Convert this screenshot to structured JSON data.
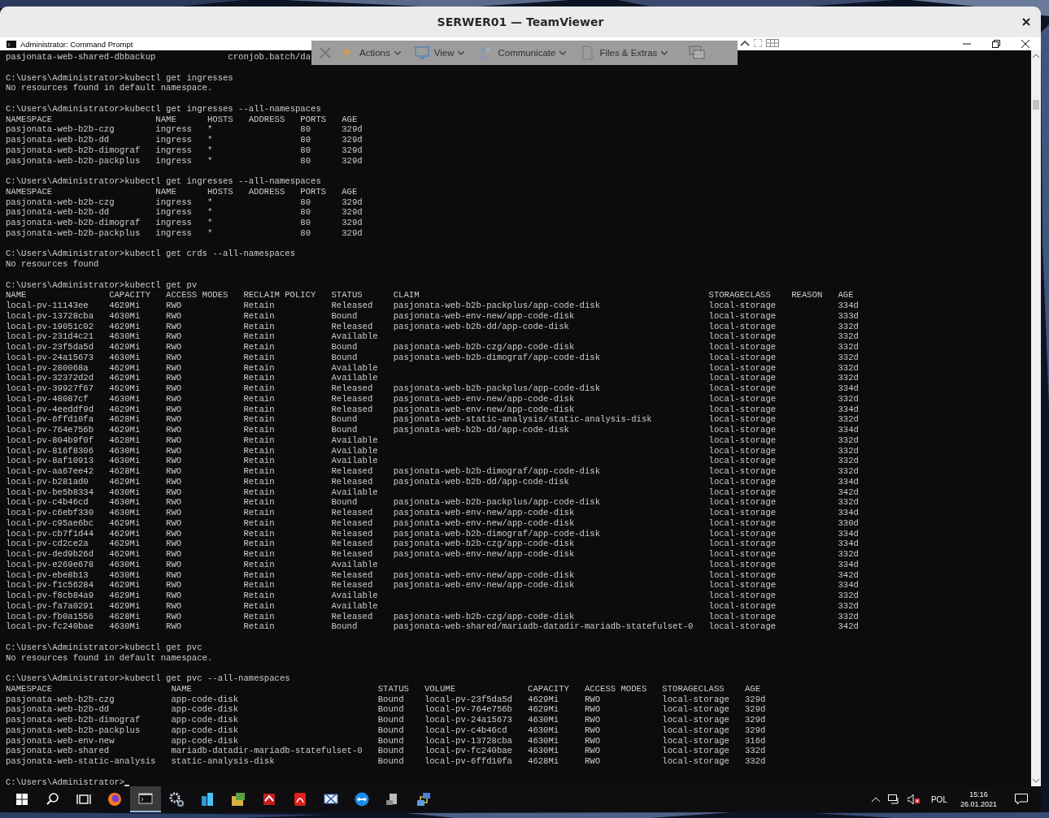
{
  "window": {
    "title": "SERWER01 — TeamViewer"
  },
  "remote_toolbar": {
    "menus": [
      {
        "label": "Actions"
      },
      {
        "label": "View"
      },
      {
        "label": "Communicate"
      },
      {
        "label": "Files & Extras"
      }
    ]
  },
  "console": {
    "title": "Administrator: Command Prompt",
    "blocks": [
      {
        "kind": "text",
        "text": "pasjonata-web-shared-dbbackup              cronjob.batch/da"
      },
      {
        "kind": "command",
        "text": "C:\\Users\\Administrator>kubectl get ingresses"
      },
      {
        "kind": "text",
        "text": "No resources found in default namespace."
      },
      {
        "kind": "command",
        "text": "C:\\Users\\Administrator>kubectl get ingresses --all-namespaces"
      },
      {
        "kind": "table",
        "columns": [
          "NAMESPACE",
          "NAME",
          "HOSTS",
          "ADDRESS",
          "PORTS",
          "AGE"
        ],
        "rows": [
          [
            "pasjonata-web-b2b-czg",
            "ingress",
            "*",
            null,
            "80",
            "329d"
          ],
          [
            "pasjonata-web-b2b-dd",
            "ingress",
            "*",
            null,
            "80",
            "329d"
          ],
          [
            "pasjonata-web-b2b-dimograf",
            "ingress",
            "*",
            null,
            "80",
            "329d"
          ],
          [
            "pasjonata-web-b2b-packplus",
            "ingress",
            "*",
            null,
            "80",
            "329d"
          ]
        ]
      },
      {
        "kind": "command",
        "text": "C:\\Users\\Administrator>kubectl get ingresses --all-namespaces"
      },
      {
        "kind": "table",
        "columns": [
          "NAMESPACE",
          "NAME",
          "HOSTS",
          "ADDRESS",
          "PORTS",
          "AGE"
        ],
        "rows": [
          [
            "pasjonata-web-b2b-czg",
            "ingress",
            "*",
            null,
            "80",
            "329d"
          ],
          [
            "pasjonata-web-b2b-dd",
            "ingress",
            "*",
            null,
            "80",
            "329d"
          ],
          [
            "pasjonata-web-b2b-dimograf",
            "ingress",
            "*",
            null,
            "80",
            "329d"
          ],
          [
            "pasjonata-web-b2b-packplus",
            "ingress",
            "*",
            null,
            "80",
            "329d"
          ]
        ]
      },
      {
        "kind": "command",
        "text": "C:\\Users\\Administrator>kubectl get crds --all-namespaces"
      },
      {
        "kind": "text",
        "text": "No resources found"
      },
      {
        "kind": "command",
        "text": "C:\\Users\\Administrator>kubectl get pv"
      },
      {
        "kind": "table",
        "columns": [
          "NAME",
          "CAPACITY",
          "ACCESS MODES",
          "RECLAIM POLICY",
          "STATUS",
          "CLAIM",
          "STORAGECLASS",
          "REASON",
          "AGE"
        ],
        "rows": [
          [
            "local-pv-11143ee",
            "4629Mi",
            "RWO",
            "Retain",
            "Released",
            "pasjonata-web-b2b-packplus/app-code-disk",
            "local-storage",
            null,
            "334d"
          ],
          [
            "local-pv-13728cba",
            "4630Mi",
            "RWO",
            "Retain",
            "Bound",
            "pasjonata-web-env-new/app-code-disk",
            "local-storage",
            null,
            "333d"
          ],
          [
            "local-pv-19051c02",
            "4629Mi",
            "RWO",
            "Retain",
            "Released",
            "pasjonata-web-b2b-dd/app-code-disk",
            "local-storage",
            null,
            "332d"
          ],
          [
            "local-pv-231d4c21",
            "4630Mi",
            "RWO",
            "Retain",
            "Available",
            null,
            "local-storage",
            null,
            "332d"
          ],
          [
            "local-pv-23f5da5d",
            "4629Mi",
            "RWO",
            "Retain",
            "Bound",
            "pasjonata-web-b2b-czg/app-code-disk",
            "local-storage",
            null,
            "332d"
          ],
          [
            "local-pv-24a15673",
            "4630Mi",
            "RWO",
            "Retain",
            "Bound",
            "pasjonata-web-b2b-dimograf/app-code-disk",
            "local-storage",
            null,
            "332d"
          ],
          [
            "local-pv-280068a",
            "4629Mi",
            "RWO",
            "Retain",
            "Available",
            null,
            "local-storage",
            null,
            "332d"
          ],
          [
            "local-pv-32372d2d",
            "4629Mi",
            "RWO",
            "Retain",
            "Available",
            null,
            "local-storage",
            null,
            "332d"
          ],
          [
            "local-pv-39927f67",
            "4629Mi",
            "RWO",
            "Retain",
            "Released",
            "pasjonata-web-b2b-packplus/app-code-disk",
            "local-storage",
            null,
            "334d"
          ],
          [
            "local-pv-48087cf",
            "4630Mi",
            "RWO",
            "Retain",
            "Released",
            "pasjonata-web-env-new/app-code-disk",
            "local-storage",
            null,
            "332d"
          ],
          [
            "local-pv-4eeddf9d",
            "4629Mi",
            "RWO",
            "Retain",
            "Released",
            "pasjonata-web-env-new/app-code-disk",
            "local-storage",
            null,
            "334d"
          ],
          [
            "local-pv-6ffd10fa",
            "4628Mi",
            "RWO",
            "Retain",
            "Bound",
            "pasjonata-web-static-analysis/static-analysis-disk",
            "local-storage",
            null,
            "332d"
          ],
          [
            "local-pv-764e756b",
            "4629Mi",
            "RWO",
            "Retain",
            "Bound",
            "pasjonata-web-b2b-dd/app-code-disk",
            "local-storage",
            null,
            "334d"
          ],
          [
            "local-pv-804b9f0f",
            "4628Mi",
            "RWO",
            "Retain",
            "Available",
            null,
            "local-storage",
            null,
            "332d"
          ],
          [
            "local-pv-816f8306",
            "4630Mi",
            "RWO",
            "Retain",
            "Available",
            null,
            "local-storage",
            null,
            "332d"
          ],
          [
            "local-pv-8af10913",
            "4630Mi",
            "RWO",
            "Retain",
            "Available",
            null,
            "local-storage",
            null,
            "332d"
          ],
          [
            "local-pv-aa67ee42",
            "4628Mi",
            "RWO",
            "Retain",
            "Released",
            "pasjonata-web-b2b-dimograf/app-code-disk",
            "local-storage",
            null,
            "332d"
          ],
          [
            "local-pv-b281ad0",
            "4629Mi",
            "RWO",
            "Retain",
            "Released",
            "pasjonata-web-b2b-dd/app-code-disk",
            "local-storage",
            null,
            "334d"
          ],
          [
            "local-pv-be5b8334",
            "4630Mi",
            "RWO",
            "Retain",
            "Available",
            null,
            "local-storage",
            null,
            "342d"
          ],
          [
            "local-pv-c4b46cd",
            "4630Mi",
            "RWO",
            "Retain",
            "Bound",
            "pasjonata-web-b2b-packplus/app-code-disk",
            "local-storage",
            null,
            "332d"
          ],
          [
            "local-pv-c6ebf330",
            "4630Mi",
            "RWO",
            "Retain",
            "Released",
            "pasjonata-web-env-new/app-code-disk",
            "local-storage",
            null,
            "334d"
          ],
          [
            "local-pv-c95ae6bc",
            "4629Mi",
            "RWO",
            "Retain",
            "Released",
            "pasjonata-web-env-new/app-code-disk",
            "local-storage",
            null,
            "330d"
          ],
          [
            "local-pv-cb7f1d44",
            "4629Mi",
            "RWO",
            "Retain",
            "Released",
            "pasjonata-web-b2b-dimograf/app-code-disk",
            "local-storage",
            null,
            "334d"
          ],
          [
            "local-pv-cd2ce2a",
            "4629Mi",
            "RWO",
            "Retain",
            "Released",
            "pasjonata-web-b2b-czg/app-code-disk",
            "local-storage",
            null,
            "334d"
          ],
          [
            "local-pv-ded9b26d",
            "4629Mi",
            "RWO",
            "Retain",
            "Released",
            "pasjonata-web-env-new/app-code-disk",
            "local-storage",
            null,
            "332d"
          ],
          [
            "local-pv-e269e678",
            "4630Mi",
            "RWO",
            "Retain",
            "Available",
            null,
            "local-storage",
            null,
            "334d"
          ],
          [
            "local-pv-ebe8b13",
            "4630Mi",
            "RWO",
            "Retain",
            "Released",
            "pasjonata-web-env-new/app-code-disk",
            "local-storage",
            null,
            "342d"
          ],
          [
            "local-pv-f1c56284",
            "4629Mi",
            "RWO",
            "Retain",
            "Released",
            "pasjonata-web-env-new/app-code-disk",
            "local-storage",
            null,
            "334d"
          ],
          [
            "local-pv-f8cb84a9",
            "4629Mi",
            "RWO",
            "Retain",
            "Available",
            null,
            "local-storage",
            null,
            "332d"
          ],
          [
            "local-pv-fa7a0291",
            "4629Mi",
            "RWO",
            "Retain",
            "Available",
            null,
            "local-storage",
            null,
            "332d"
          ],
          [
            "local-pv-fb0a1556",
            "4628Mi",
            "RWO",
            "Retain",
            "Released",
            "pasjonata-web-b2b-czg/app-code-disk",
            "local-storage",
            null,
            "332d"
          ],
          [
            "local-pv-fc240bae",
            "4630Mi",
            "RWO",
            "Retain",
            "Bound",
            "pasjonata-web-shared/mariadb-datadir-mariadb-statefulset-0",
            "local-storage",
            null,
            "342d"
          ]
        ]
      },
      {
        "kind": "command",
        "text": "C:\\Users\\Administrator>kubectl get pvc"
      },
      {
        "kind": "text",
        "text": "No resources found in default namespace."
      },
      {
        "kind": "command",
        "text": "C:\\Users\\Administrator>kubectl get pvc --all-namespaces"
      },
      {
        "kind": "table",
        "columns": [
          "NAMESPACE",
          "NAME",
          "STATUS",
          "VOLUME",
          "CAPACITY",
          "ACCESS MODES",
          "STORAGECLASS",
          "AGE"
        ],
        "rows": [
          [
            "pasjonata-web-b2b-czg",
            "app-code-disk",
            "Bound",
            "local-pv-23f5da5d",
            "4629Mi",
            "RWO",
            "local-storage",
            "329d"
          ],
          [
            "pasjonata-web-b2b-dd",
            "app-code-disk",
            "Bound",
            "local-pv-764e756b",
            "4629Mi",
            "RWO",
            "local-storage",
            "329d"
          ],
          [
            "pasjonata-web-b2b-dimograf",
            "app-code-disk",
            "Bound",
            "local-pv-24a15673",
            "4630Mi",
            "RWO",
            "local-storage",
            "329d"
          ],
          [
            "pasjonata-web-b2b-packplus",
            "app-code-disk",
            "Bound",
            "local-pv-c4b46cd",
            "4630Mi",
            "RWO",
            "local-storage",
            "329d"
          ],
          [
            "pasjonata-web-env-new",
            "app-code-disk",
            "Bound",
            "local-pv-13728cba",
            "4630Mi",
            "RWO",
            "local-storage",
            "316d"
          ],
          [
            "pasjonata-web-shared",
            "mariadb-datadir-mariadb-statefulset-0",
            "Bound",
            "local-pv-fc240bae",
            "4630Mi",
            "RWO",
            "local-storage",
            "332d"
          ],
          [
            "pasjonata-web-static-analysis",
            "static-analysis-disk",
            "Bound",
            "local-pv-6ffd10fa",
            "4628Mi",
            "RWO",
            "local-storage",
            "332d"
          ]
        ]
      },
      {
        "kind": "prompt",
        "text": "C:\\Users\\Administrator>"
      }
    ]
  },
  "taskbar": {
    "buttons": [
      {
        "selected": false
      },
      {
        "selected": false
      },
      {
        "selected": false
      },
      {
        "selected": false
      },
      {
        "selected": true
      },
      {
        "selected": false
      },
      {
        "selected": false
      },
      {
        "selected": false
      },
      {
        "selected": false
      },
      {
        "selected": false
      },
      {
        "selected": false
      },
      {
        "selected": false
      },
      {
        "selected": false
      },
      {
        "selected": false
      }
    ],
    "language": "POL",
    "time": "15:16",
    "date": "26.01.2021"
  }
}
